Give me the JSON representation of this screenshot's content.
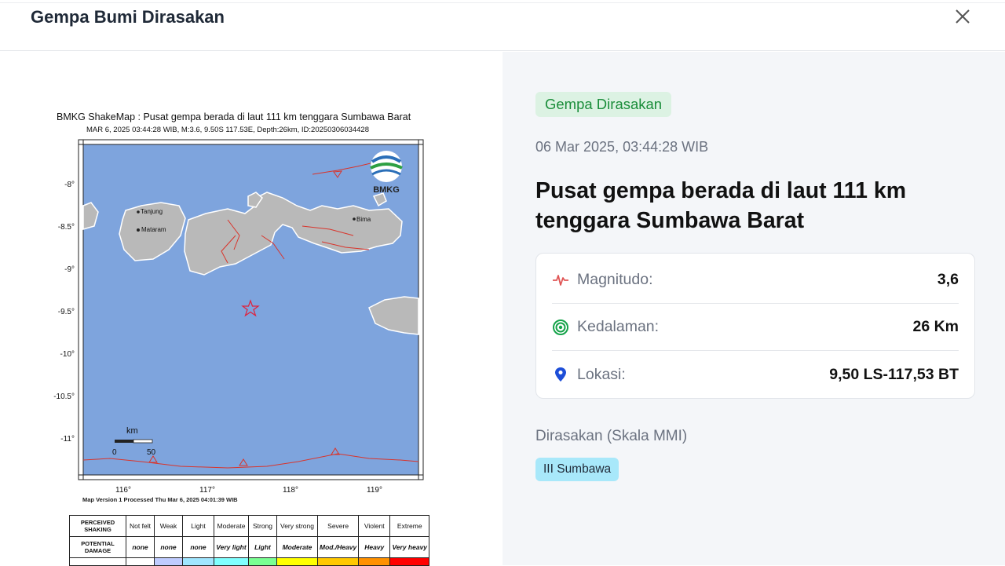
{
  "modal": {
    "title": "Gempa Bumi Dirasakan",
    "close_icon": "close-icon"
  },
  "shakemap": {
    "title": "BMKG ShakeMap : Pusat gempa berada di laut 111 km tenggara Sumbawa Barat",
    "subtitle": "MAR 6, 2025 03:44:28 WIB, M:3.6, 9.50S 117.53E, Depth:26km, ID:20250306034428",
    "logo_text": "BMKG",
    "y_ticks": [
      "-8°",
      "-8.5°",
      "-9°",
      "-9.5°",
      "-10°",
      "-10.5°",
      "-11°"
    ],
    "x_ticks": [
      "116°",
      "117°",
      "118°",
      "119°"
    ],
    "places": [
      "Tanjung",
      "Mataram",
      "Bima"
    ],
    "scale_unit": "km",
    "scale_labels": [
      "0",
      "50"
    ],
    "footer": "Map Version 1 Processed Thu Mar  6, 2025 04:01:39 WIB",
    "colors": {
      "sea": "#7ea4dd",
      "land": "#bfbfbf",
      "fault": "#d9342b",
      "epicenter": "#e0203a"
    },
    "legend": {
      "row1_head": [
        "PERCEIVED",
        "SHAKING"
      ],
      "row1": [
        "Not felt",
        "Weak",
        "Light",
        "Moderate",
        "Strong",
        "Very strong",
        "Severe",
        "Violent",
        "Extreme"
      ],
      "row2_head": [
        "POTENTIAL",
        "DAMAGE"
      ],
      "row2": [
        "none",
        "none",
        "none",
        "Very light",
        "Light",
        "Moderate",
        "Mod./Heavy",
        "Heavy",
        "Very heavy"
      ],
      "colors": [
        "#ffffff",
        "#bfccff",
        "#a0e6ff",
        "#80ffff",
        "#7aff93",
        "#ffff00",
        "#ffc800",
        "#ff9100",
        "#ff0000"
      ]
    }
  },
  "event": {
    "badge": "Gempa Dirasakan",
    "datetime": "06 Mar 2025, 03:44:28 WIB",
    "headline": "Pusat gempa berada di laut 111 km tenggara Sumbawa Barat",
    "magnitude_label": "Magnitudo:",
    "magnitude_value": "3,6",
    "magnitude_icon": "activity-pulse-icon",
    "depth_label": "Kedalaman:",
    "depth_value": "26 Km",
    "depth_icon": "target-rings-icon",
    "location_label": "Lokasi:",
    "location_value": "9,50 LS-117,53 BT",
    "location_icon": "map-pin-icon",
    "mmi_label": "Dirasakan (Skala MMI)",
    "mmi_value": "III Sumbawa",
    "colors": {
      "badge_bg": "#dcf2e3",
      "badge_text": "#1a8d3a",
      "pulse": "#e05555",
      "target": "#16a34a",
      "pin": "#1d4ed8",
      "mmi_bg": "#a8e8fa"
    }
  }
}
